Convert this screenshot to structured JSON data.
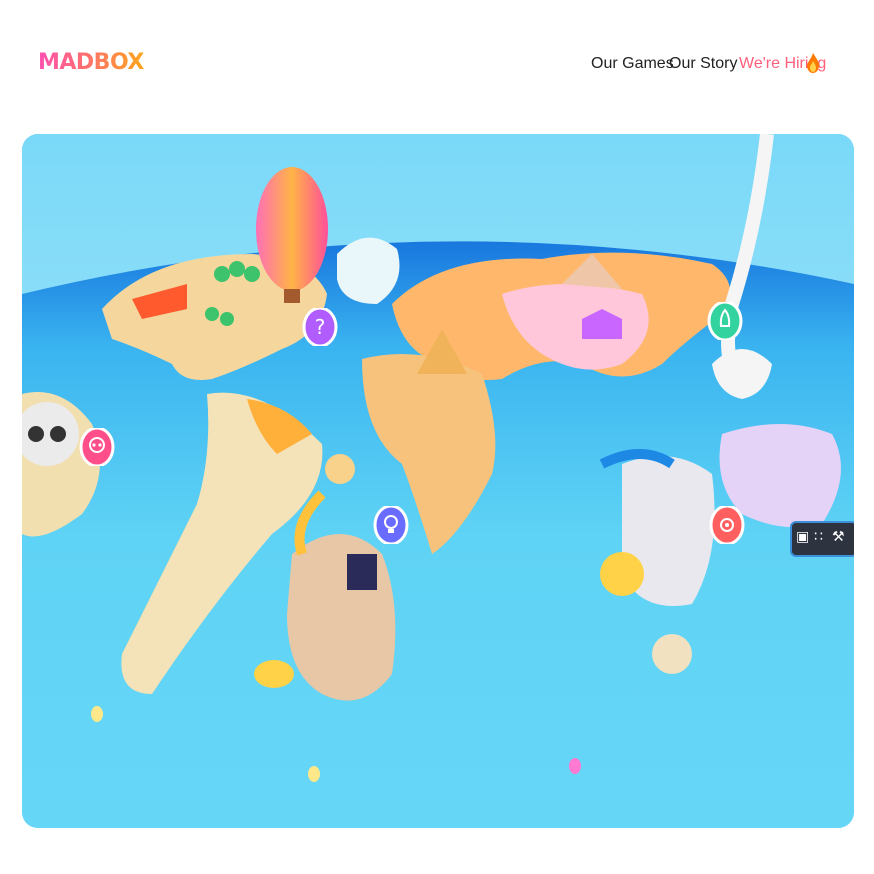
{
  "brand": {
    "logo_text": "MADBOX"
  },
  "nav": {
    "items": [
      {
        "label": "Our Games"
      },
      {
        "label": "Our Story"
      },
      {
        "label": "We're Hiring"
      }
    ]
  },
  "hero": {
    "badges": [
      {
        "icon": "question-icon",
        "color": "#b05cff"
      },
      {
        "icon": "skull-icon",
        "color": "#ff4f8b"
      },
      {
        "icon": "lightbulb-icon",
        "color": "#6a6cff"
      },
      {
        "icon": "rocket-icon",
        "color": "#33d3a0"
      },
      {
        "icon": "gear-icon",
        "color": "#ff5f5f"
      }
    ]
  },
  "colors": {
    "accent": "#ff5f7a",
    "ocean": "#5fd3f5",
    "ocean_deep": "#1a86df"
  }
}
